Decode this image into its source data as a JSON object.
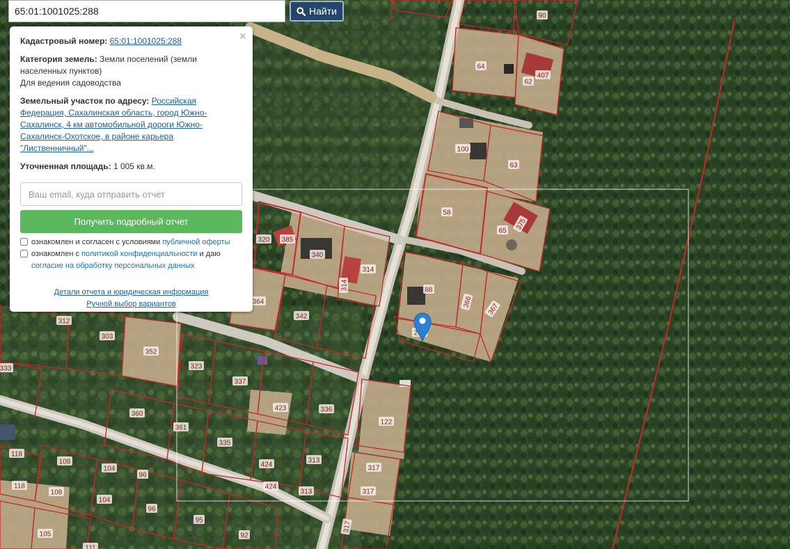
{
  "search": {
    "query": "65:01:1001025:288",
    "button_label": "Найти",
    "button_icon": "search-icon"
  },
  "panel": {
    "close_symbol": "×",
    "cadastral_label": "Кадастровый номер:",
    "cadastral_value": "65:01:1001025:288",
    "category_label": "Категория земель:",
    "category_value": "Земли поселений (земли населенных пунктов)",
    "usage": "Для ведения садоводства",
    "address_label": "Земельный участок по адресу:",
    "address_value": "Российская Федерация, Сахалинская область, город Южно-Сахалинск, 4 км автомобильной дороги Южно-Сахалинск-Охотское, в районе карьера \"Лиственничный\"...",
    "area_label": "Уточненная площадь:",
    "area_value": "1 005 кв.м.",
    "email_placeholder": "Ваш email, куда отправить отчет",
    "report_button": "Получить подробный отчет",
    "consent1_text": "ознакомлен и согласен с условиями ",
    "consent1_link": "публичной оферты",
    "consent2_text_a": "ознакомлен с ",
    "consent2_link_a": "политикой конфиденциальности",
    "consent2_text_b": " и даю ",
    "consent2_link_b": "согласие на обработку персональных данных",
    "details_link": "Детали отчета и юридическая информация",
    "manual_link": "Ручной выбор вариантов"
  },
  "map": {
    "marker_icon": "location-pin-icon",
    "colors": {
      "boundary": "#c4282a",
      "selection": "#ffffff",
      "marker": "#2a82d6"
    },
    "plot_numbers": [
      "90",
      "64",
      "407",
      "62",
      "100",
      "63",
      "58",
      "65",
      "375",
      "320",
      "385",
      "340",
      "314",
      "314",
      "364",
      "88",
      "366",
      "367",
      "342",
      "312",
      "303",
      "352",
      "333",
      "323",
      "337",
      "423",
      "336",
      "122",
      "360",
      "361",
      "335",
      "313",
      "424",
      "317",
      "317",
      "118",
      "108",
      "104",
      "96",
      "118",
      "108",
      "104",
      "96",
      "95",
      "92",
      "105",
      "111",
      "424",
      "313",
      "317",
      "288"
    ]
  }
}
